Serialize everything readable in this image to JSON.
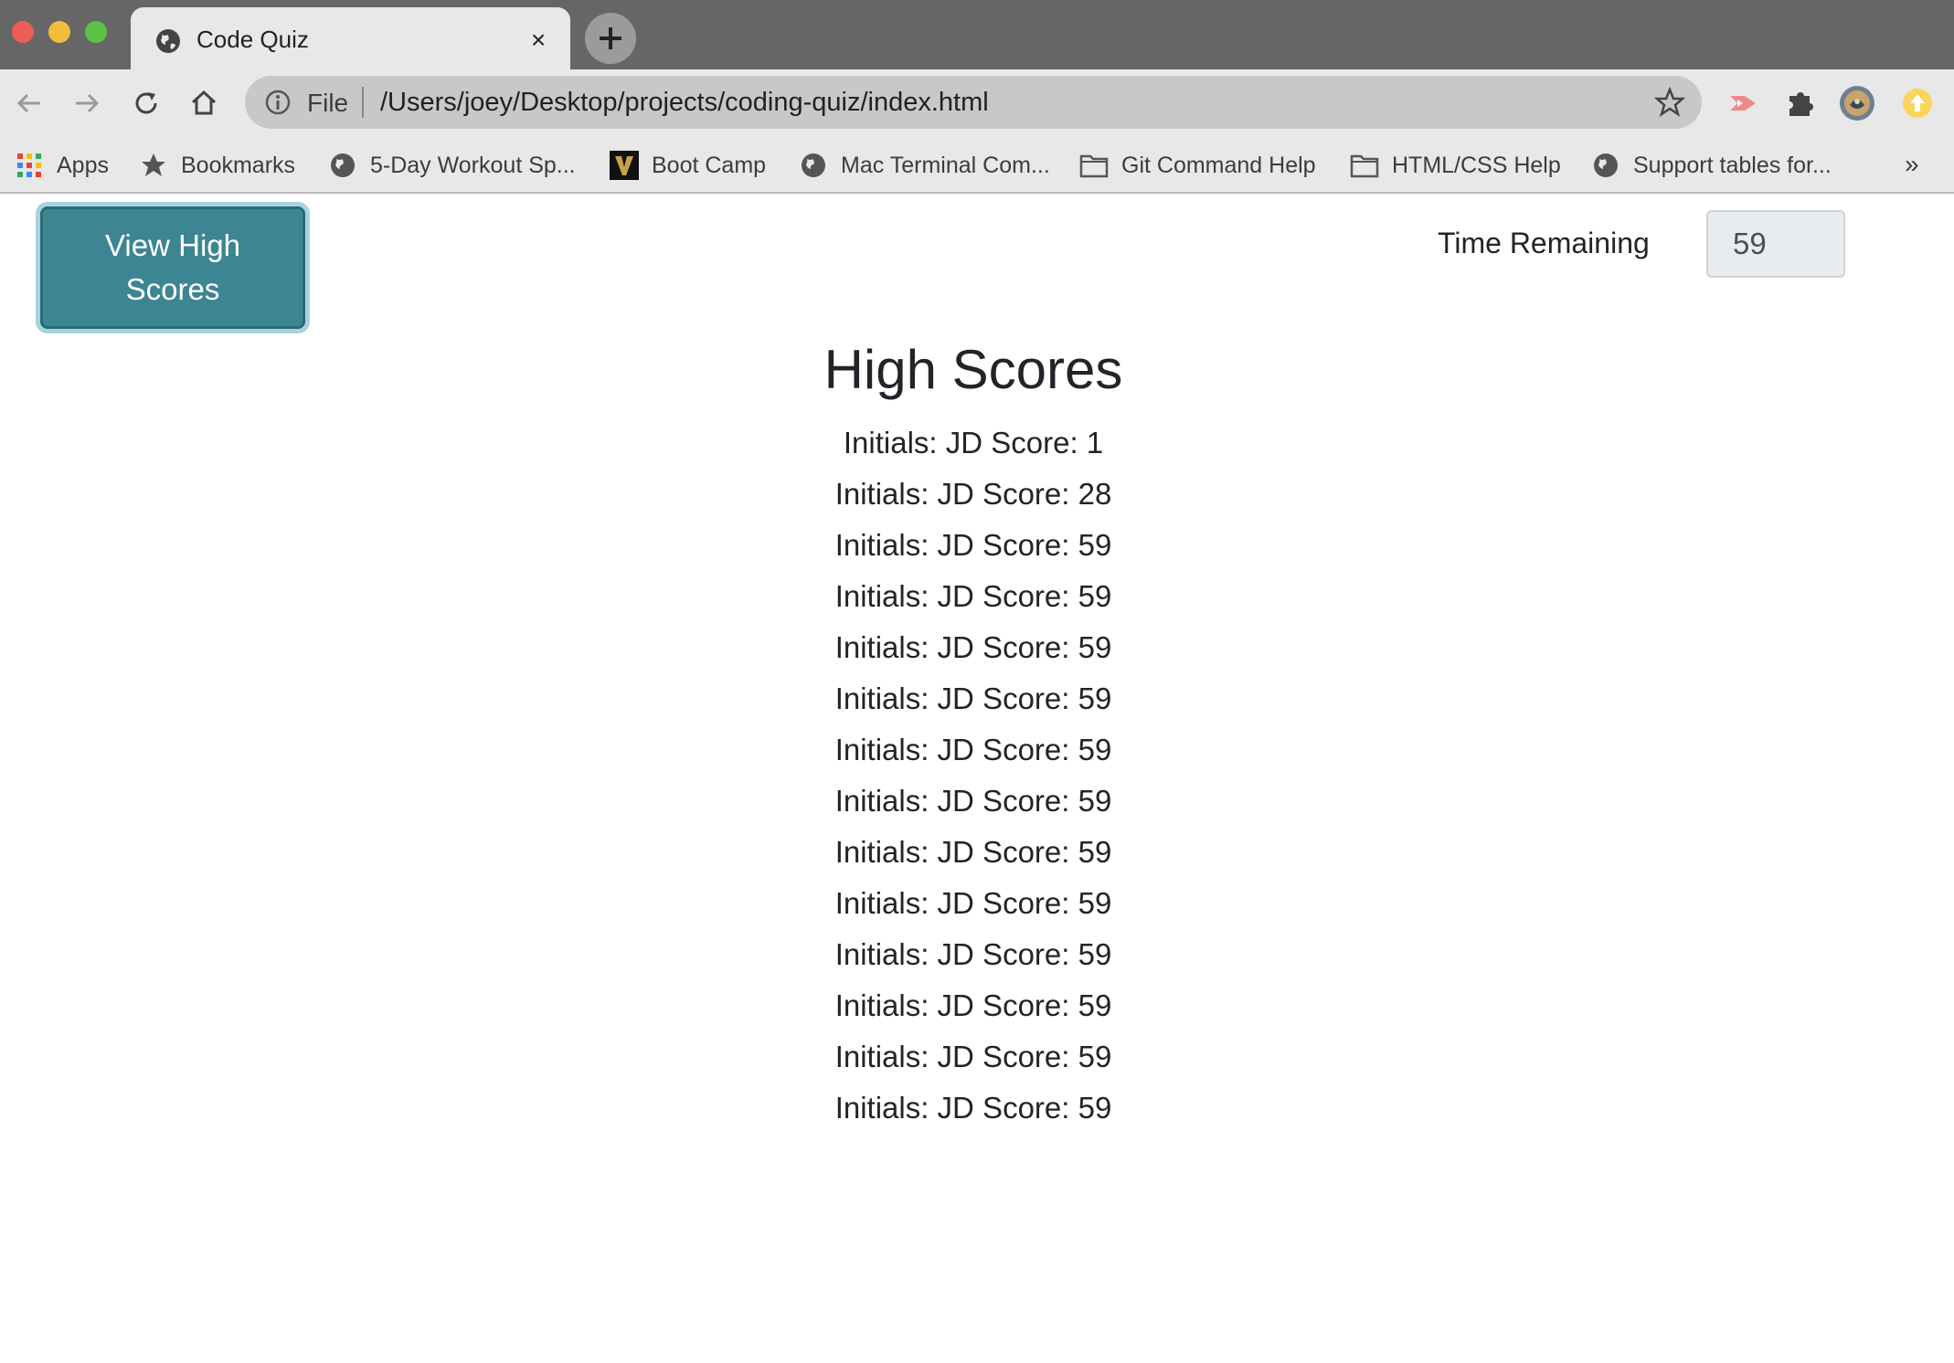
{
  "browser": {
    "tab_title": "Code Quiz",
    "tab_close": "×",
    "omnibox_scheme": "File",
    "omnibox_url": "/Users/joey/Desktop/projects/coding-quiz/index.html",
    "more_bookmarks": "»"
  },
  "bookmarks": [
    {
      "label": "Apps",
      "icon": "apps-grid-icon"
    },
    {
      "label": "Bookmarks",
      "icon": "star-icon"
    },
    {
      "label": "5-Day Workout Sp...",
      "icon": "globe-icon"
    },
    {
      "label": "Boot Camp",
      "icon": "vanderbilt-v-icon"
    },
    {
      "label": "Mac Terminal Com...",
      "icon": "globe-icon"
    },
    {
      "label": "Git Command Help",
      "icon": "folder-icon"
    },
    {
      "label": "HTML/CSS Help",
      "icon": "folder-icon"
    },
    {
      "label": "Support tables for...",
      "icon": "globe-icon"
    }
  ],
  "page": {
    "view_high_scores_label": "View High Scores",
    "time_remaining_label": "Time Remaining",
    "time_remaining_value": "59",
    "high_scores_title": "High Scores",
    "scores": [
      "Initials: JD Score: 1",
      "Initials: JD Score: 28",
      "Initials: JD Score: 59",
      "Initials: JD Score: 59",
      "Initials: JD Score: 59",
      "Initials: JD Score: 59",
      "Initials: JD Score: 59",
      "Initials: JD Score: 59",
      "Initials: JD Score: 59",
      "Initials: JD Score: 59",
      "Initials: JD Score: 59",
      "Initials: JD Score: 59",
      "Initials: JD Score: 59",
      "Initials: JD Score: 59"
    ]
  },
  "colors": {
    "button_bg": "#3d8593",
    "button_ring": "#a7d3dd",
    "chrome_frame": "#666666",
    "chrome_toolbar": "#e8e8e8"
  }
}
